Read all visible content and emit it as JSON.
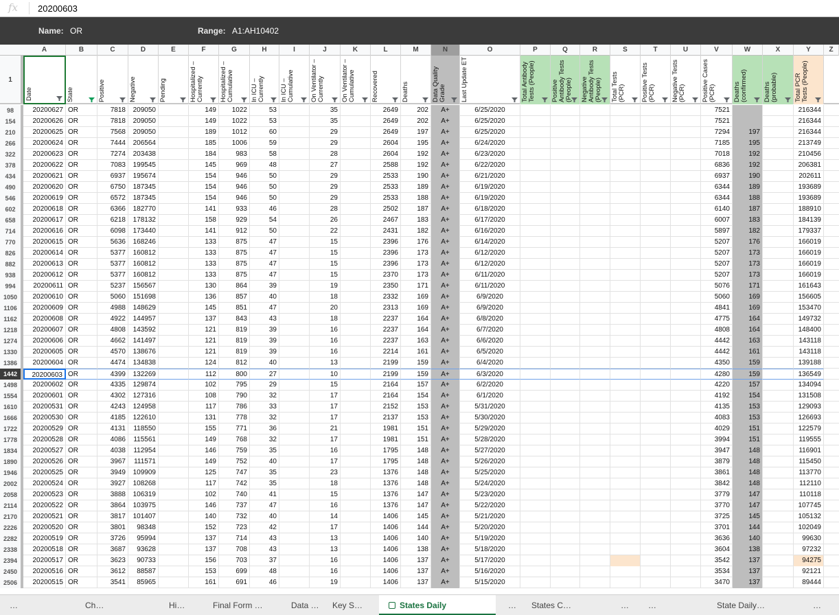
{
  "formula_bar": {
    "icon": "fx",
    "value": "20200603"
  },
  "named_range": {
    "name_label": "Name:",
    "name_value": "OR",
    "range_label": "Range:",
    "range_value": "A1:AH10402"
  },
  "column_letters": [
    "A",
    "B",
    "C",
    "D",
    "E",
    "F",
    "G",
    "H",
    "I",
    "J",
    "K",
    "L",
    "M",
    "N",
    "O",
    "P",
    "Q",
    "R",
    "S",
    "T",
    "U",
    "V",
    "W",
    "X",
    "Y",
    "Z"
  ],
  "header_row_number": "1",
  "headers": [
    "Date",
    "State",
    "Positive",
    "Negative",
    "Pending",
    "Hospitalized – Currently",
    "Hospitalized – Cumulative",
    "In ICU – Currently",
    "In ICU – Cumulative",
    "On Ventilator – Currently",
    "On Ventilator – Cumulative",
    "Recovered",
    "Deaths",
    "Data Quality Grade",
    "Last Update ET",
    "Total Antibody Tests (People)",
    "Positive Antibody Tests (People)",
    "Negative Antibody Tests (People)",
    "Total Tests (PCR)",
    "Positive Tests (PCR)",
    "Negative Tests (PCR)",
    "Positive Cases (PCR)",
    "Deaths (confirmed)",
    "Deaths (probable)",
    "Total PCR Tests (People)"
  ],
  "colors": {
    "green_header": "#b7e1b7",
    "grey_column": "#bdbdbd",
    "orange_header": "#fce5cd",
    "orange_cell": "#fce5cd",
    "selected_border": "#6fa0e8",
    "tab_accent": "#1a7340"
  },
  "rows": [
    [
      "98",
      "20200627",
      "OR",
      "7818",
      "209050",
      "",
      "149",
      "1022",
      "53",
      "",
      "35",
      "",
      "2649",
      "202",
      "A+",
      "6/25/2020",
      "",
      "",
      "",
      "",
      "",
      "",
      "7521",
      "",
      "",
      "216344"
    ],
    [
      "154",
      "20200626",
      "OR",
      "7818",
      "209050",
      "",
      "149",
      "1022",
      "53",
      "",
      "35",
      "",
      "2649",
      "202",
      "A+",
      "6/25/2020",
      "",
      "",
      "",
      "",
      "",
      "",
      "7521",
      "",
      "",
      "216344"
    ],
    [
      "210",
      "20200625",
      "OR",
      "7568",
      "209050",
      "",
      "189",
      "1012",
      "60",
      "",
      "29",
      "",
      "2649",
      "197",
      "A+",
      "6/25/2020",
      "",
      "",
      "",
      "",
      "",
      "",
      "7294",
      "197",
      "",
      "216344"
    ],
    [
      "266",
      "20200624",
      "OR",
      "7444",
      "206564",
      "",
      "185",
      "1006",
      "59",
      "",
      "29",
      "",
      "2604",
      "195",
      "A+",
      "6/24/2020",
      "",
      "",
      "",
      "",
      "",
      "",
      "7185",
      "195",
      "",
      "213749"
    ],
    [
      "322",
      "20200623",
      "OR",
      "7274",
      "203438",
      "",
      "184",
      "983",
      "58",
      "",
      "28",
      "",
      "2604",
      "192",
      "A+",
      "6/23/2020",
      "",
      "",
      "",
      "",
      "",
      "",
      "7018",
      "192",
      "",
      "210456"
    ],
    [
      "378",
      "20200622",
      "OR",
      "7083",
      "199545",
      "",
      "145",
      "969",
      "48",
      "",
      "27",
      "",
      "2588",
      "192",
      "A+",
      "6/22/2020",
      "",
      "",
      "",
      "",
      "",
      "",
      "6836",
      "192",
      "",
      "206381"
    ],
    [
      "434",
      "20200621",
      "OR",
      "6937",
      "195674",
      "",
      "154",
      "946",
      "50",
      "",
      "29",
      "",
      "2533",
      "190",
      "A+",
      "6/21/2020",
      "",
      "",
      "",
      "",
      "",
      "",
      "6937",
      "190",
      "",
      "202611"
    ],
    [
      "490",
      "20200620",
      "OR",
      "6750",
      "187345",
      "",
      "154",
      "946",
      "50",
      "",
      "29",
      "",
      "2533",
      "189",
      "A+",
      "6/19/2020",
      "",
      "",
      "",
      "",
      "",
      "",
      "6344",
      "189",
      "",
      "193689"
    ],
    [
      "546",
      "20200619",
      "OR",
      "6572",
      "187345",
      "",
      "154",
      "946",
      "50",
      "",
      "29",
      "",
      "2533",
      "188",
      "A+",
      "6/19/2020",
      "",
      "",
      "",
      "",
      "",
      "",
      "6344",
      "188",
      "",
      "193689"
    ],
    [
      "602",
      "20200618",
      "OR",
      "6366",
      "182770",
      "",
      "141",
      "933",
      "46",
      "",
      "28",
      "",
      "2502",
      "187",
      "A+",
      "6/18/2020",
      "",
      "",
      "",
      "",
      "",
      "",
      "6140",
      "187",
      "",
      "188910"
    ],
    [
      "658",
      "20200617",
      "OR",
      "6218",
      "178132",
      "",
      "158",
      "929",
      "54",
      "",
      "26",
      "",
      "2467",
      "183",
      "A+",
      "6/17/2020",
      "",
      "",
      "",
      "",
      "",
      "",
      "6007",
      "183",
      "",
      "184139"
    ],
    [
      "714",
      "20200616",
      "OR",
      "6098",
      "173440",
      "",
      "141",
      "912",
      "50",
      "",
      "22",
      "",
      "2431",
      "182",
      "A+",
      "6/16/2020",
      "",
      "",
      "",
      "",
      "",
      "",
      "5897",
      "182",
      "",
      "179337"
    ],
    [
      "770",
      "20200615",
      "OR",
      "5636",
      "168246",
      "",
      "133",
      "875",
      "47",
      "",
      "15",
      "",
      "2396",
      "176",
      "A+",
      "6/14/2020",
      "",
      "",
      "",
      "",
      "",
      "",
      "5207",
      "176",
      "",
      "166019"
    ],
    [
      "826",
      "20200614",
      "OR",
      "5377",
      "160812",
      "",
      "133",
      "875",
      "47",
      "",
      "15",
      "",
      "2396",
      "173",
      "A+",
      "6/12/2020",
      "",
      "",
      "",
      "",
      "",
      "",
      "5207",
      "173",
      "",
      "166019"
    ],
    [
      "882",
      "20200613",
      "OR",
      "5377",
      "160812",
      "",
      "133",
      "875",
      "47",
      "",
      "15",
      "",
      "2396",
      "173",
      "A+",
      "6/12/2020",
      "",
      "",
      "",
      "",
      "",
      "",
      "5207",
      "173",
      "",
      "166019"
    ],
    [
      "938",
      "20200612",
      "OR",
      "5377",
      "160812",
      "",
      "133",
      "875",
      "47",
      "",
      "15",
      "",
      "2370",
      "173",
      "A+",
      "6/11/2020",
      "",
      "",
      "",
      "",
      "",
      "",
      "5207",
      "173",
      "",
      "166019"
    ],
    [
      "994",
      "20200611",
      "OR",
      "5237",
      "156567",
      "",
      "130",
      "864",
      "39",
      "",
      "19",
      "",
      "2350",
      "171",
      "A+",
      "6/11/2020",
      "",
      "",
      "",
      "",
      "",
      "",
      "5076",
      "171",
      "",
      "161643"
    ],
    [
      "1050",
      "20200610",
      "OR",
      "5060",
      "151698",
      "",
      "136",
      "857",
      "40",
      "",
      "18",
      "",
      "2332",
      "169",
      "A+",
      "6/9/2020",
      "",
      "",
      "",
      "",
      "",
      "",
      "5060",
      "169",
      "",
      "156605"
    ],
    [
      "1106",
      "20200609",
      "OR",
      "4988",
      "148629",
      "",
      "145",
      "851",
      "47",
      "",
      "20",
      "",
      "2313",
      "169",
      "A+",
      "6/9/2020",
      "",
      "",
      "",
      "",
      "",
      "",
      "4841",
      "169",
      "",
      "153470"
    ],
    [
      "1162",
      "20200608",
      "OR",
      "4922",
      "144957",
      "",
      "137",
      "843",
      "43",
      "",
      "18",
      "",
      "2237",
      "164",
      "A+",
      "6/8/2020",
      "",
      "",
      "",
      "",
      "",
      "",
      "4775",
      "164",
      "",
      "149732"
    ],
    [
      "1218",
      "20200607",
      "OR",
      "4808",
      "143592",
      "",
      "121",
      "819",
      "39",
      "",
      "16",
      "",
      "2237",
      "164",
      "A+",
      "6/7/2020",
      "",
      "",
      "",
      "",
      "",
      "",
      "4808",
      "164",
      "",
      "148400"
    ],
    [
      "1274",
      "20200606",
      "OR",
      "4662",
      "141497",
      "",
      "121",
      "819",
      "39",
      "",
      "16",
      "",
      "2237",
      "163",
      "A+",
      "6/6/2020",
      "",
      "",
      "",
      "",
      "",
      "",
      "4442",
      "163",
      "",
      "143118"
    ],
    [
      "1330",
      "20200605",
      "OR",
      "4570",
      "138676",
      "",
      "121",
      "819",
      "39",
      "",
      "16",
      "",
      "2214",
      "161",
      "A+",
      "6/5/2020",
      "",
      "",
      "",
      "",
      "",
      "",
      "4442",
      "161",
      "",
      "143118"
    ],
    [
      "1386",
      "20200604",
      "OR",
      "4474",
      "134838",
      "",
      "124",
      "812",
      "40",
      "",
      "13",
      "",
      "2199",
      "159",
      "A+",
      "6/4/2020",
      "",
      "",
      "",
      "",
      "",
      "",
      "4350",
      "159",
      "",
      "139188"
    ],
    [
      "1442",
      "20200603",
      "OR",
      "4399",
      "132269",
      "",
      "112",
      "800",
      "27",
      "",
      "10",
      "",
      "2199",
      "159",
      "A+",
      "6/3/2020",
      "",
      "",
      "",
      "",
      "",
      "",
      "4280",
      "159",
      "",
      "136549"
    ],
    [
      "1498",
      "20200602",
      "OR",
      "4335",
      "129874",
      "",
      "102",
      "795",
      "29",
      "",
      "15",
      "",
      "2164",
      "157",
      "A+",
      "6/2/2020",
      "",
      "",
      "",
      "",
      "",
      "",
      "4220",
      "157",
      "",
      "134094"
    ],
    [
      "1554",
      "20200601",
      "OR",
      "4302",
      "127316",
      "",
      "108",
      "790",
      "32",
      "",
      "17",
      "",
      "2164",
      "154",
      "A+",
      "6/1/2020",
      "",
      "",
      "",
      "",
      "",
      "",
      "4192",
      "154",
      "",
      "131508"
    ],
    [
      "1610",
      "20200531",
      "OR",
      "4243",
      "124958",
      "",
      "117",
      "786",
      "33",
      "",
      "17",
      "",
      "2152",
      "153",
      "A+",
      "5/31/2020",
      "",
      "",
      "",
      "",
      "",
      "",
      "4135",
      "153",
      "",
      "129093"
    ],
    [
      "1666",
      "20200530",
      "OR",
      "4185",
      "122610",
      "",
      "131",
      "778",
      "32",
      "",
      "17",
      "",
      "2137",
      "153",
      "A+",
      "5/30/2020",
      "",
      "",
      "",
      "",
      "",
      "",
      "4083",
      "153",
      "",
      "126693"
    ],
    [
      "1722",
      "20200529",
      "OR",
      "4131",
      "118550",
      "",
      "155",
      "771",
      "36",
      "",
      "21",
      "",
      "1981",
      "151",
      "A+",
      "5/29/2020",
      "",
      "",
      "",
      "",
      "",
      "",
      "4029",
      "151",
      "",
      "122579"
    ],
    [
      "1778",
      "20200528",
      "OR",
      "4086",
      "115561",
      "",
      "149",
      "768",
      "32",
      "",
      "17",
      "",
      "1981",
      "151",
      "A+",
      "5/28/2020",
      "",
      "",
      "",
      "",
      "",
      "",
      "3994",
      "151",
      "",
      "119555"
    ],
    [
      "1834",
      "20200527",
      "OR",
      "4038",
      "112954",
      "",
      "146",
      "759",
      "35",
      "",
      "16",
      "",
      "1795",
      "148",
      "A+",
      "5/27/2020",
      "",
      "",
      "",
      "",
      "",
      "",
      "3947",
      "148",
      "",
      "116901"
    ],
    [
      "1890",
      "20200526",
      "OR",
      "3967",
      "111571",
      "",
      "149",
      "752",
      "40",
      "",
      "17",
      "",
      "1795",
      "148",
      "A+",
      "5/26/2020",
      "",
      "",
      "",
      "",
      "",
      "",
      "3879",
      "148",
      "",
      "115450"
    ],
    [
      "1946",
      "20200525",
      "OR",
      "3949",
      "109909",
      "",
      "125",
      "747",
      "35",
      "",
      "23",
      "",
      "1376",
      "148",
      "A+",
      "5/25/2020",
      "",
      "",
      "",
      "",
      "",
      "",
      "3861",
      "148",
      "",
      "113770"
    ],
    [
      "2002",
      "20200524",
      "OR",
      "3927",
      "108268",
      "",
      "117",
      "742",
      "35",
      "",
      "18",
      "",
      "1376",
      "148",
      "A+",
      "5/24/2020",
      "",
      "",
      "",
      "",
      "",
      "",
      "3842",
      "148",
      "",
      "112110"
    ],
    [
      "2058",
      "20200523",
      "OR",
      "3888",
      "106319",
      "",
      "102",
      "740",
      "41",
      "",
      "15",
      "",
      "1376",
      "147",
      "A+",
      "5/23/2020",
      "",
      "",
      "",
      "",
      "",
      "",
      "3779",
      "147",
      "",
      "110118"
    ],
    [
      "2114",
      "20200522",
      "OR",
      "3864",
      "103975",
      "",
      "146",
      "737",
      "47",
      "",
      "16",
      "",
      "1376",
      "147",
      "A+",
      "5/22/2020",
      "",
      "",
      "",
      "",
      "",
      "",
      "3770",
      "147",
      "",
      "107745"
    ],
    [
      "2170",
      "20200521",
      "OR",
      "3817",
      "101407",
      "",
      "140",
      "732",
      "40",
      "",
      "14",
      "",
      "1406",
      "145",
      "A+",
      "5/21/2020",
      "",
      "",
      "",
      "",
      "",
      "",
      "3725",
      "145",
      "",
      "105132"
    ],
    [
      "2226",
      "20200520",
      "OR",
      "3801",
      "98348",
      "",
      "152",
      "723",
      "42",
      "",
      "17",
      "",
      "1406",
      "144",
      "A+",
      "5/20/2020",
      "",
      "",
      "",
      "",
      "",
      "",
      "3701",
      "144",
      "",
      "102049"
    ],
    [
      "2282",
      "20200519",
      "OR",
      "3726",
      "95994",
      "",
      "137",
      "714",
      "43",
      "",
      "13",
      "",
      "1406",
      "140",
      "A+",
      "5/19/2020",
      "",
      "",
      "",
      "",
      "",
      "",
      "3636",
      "140",
      "",
      "99630"
    ],
    [
      "2338",
      "20200518",
      "OR",
      "3687",
      "93628",
      "",
      "137",
      "708",
      "43",
      "",
      "13",
      "",
      "1406",
      "138",
      "A+",
      "5/18/2020",
      "",
      "",
      "",
      "",
      "",
      "",
      "3604",
      "138",
      "",
      "97232"
    ],
    [
      "2394",
      "20200517",
      "OR",
      "3623",
      "90733",
      "",
      "156",
      "703",
      "37",
      "",
      "16",
      "",
      "1406",
      "137",
      "A+",
      "5/17/2020",
      "",
      "",
      "",
      "",
      "",
      "",
      "3542",
      "137",
      "",
      "94275"
    ],
    [
      "2450",
      "20200516",
      "OR",
      "3612",
      "88587",
      "",
      "153",
      "699",
      "48",
      "",
      "16",
      "",
      "1406",
      "137",
      "A+",
      "5/16/2020",
      "",
      "",
      "",
      "",
      "",
      "",
      "3534",
      "137",
      "",
      "92121"
    ],
    [
      "2506",
      "20200515",
      "OR",
      "3541",
      "85965",
      "",
      "161",
      "691",
      "46",
      "",
      "19",
      "",
      "1406",
      "137",
      "A+",
      "5/15/2020",
      "",
      "",
      "",
      "",
      "",
      "",
      "3470",
      "137",
      "",
      "89444"
    ]
  ],
  "selected_row": "1442",
  "tabs": [
    {
      "label": "…"
    },
    {
      "label": "Ch…"
    },
    {
      "label": "Hi…"
    },
    {
      "label": "Final Form …"
    },
    {
      "label": "Data …"
    },
    {
      "label": "Key S…"
    },
    {
      "label": "States Daily",
      "active": true
    },
    {
      "label": "…"
    },
    {
      "label": "States C…"
    },
    {
      "label": "…"
    },
    {
      "label": "…"
    },
    {
      "label": "State Daily…"
    },
    {
      "label": "…"
    }
  ]
}
